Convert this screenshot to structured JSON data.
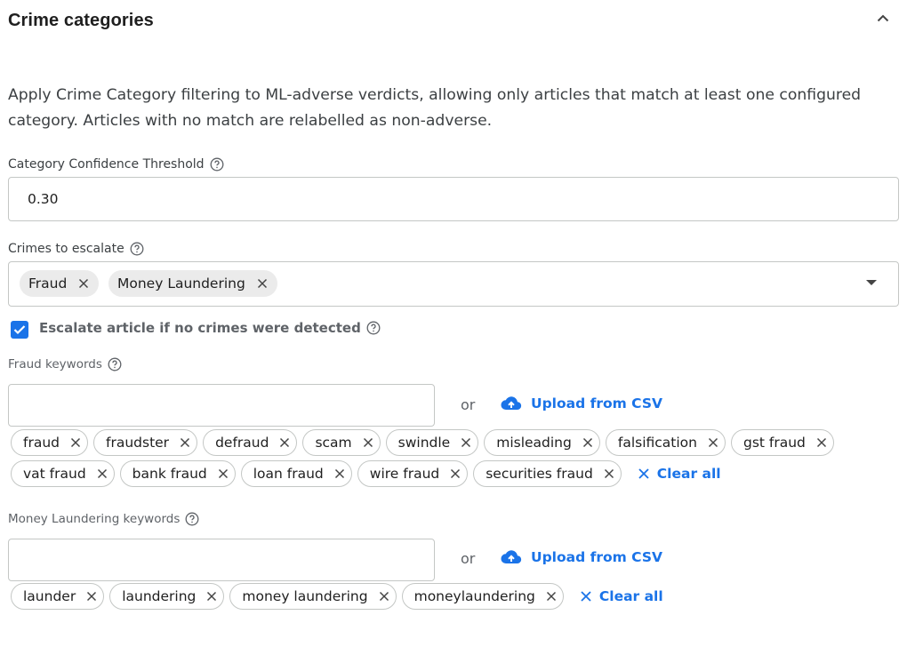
{
  "section": {
    "title": "Crime categories",
    "description": "Apply Crime Category filtering to ML-adverse verdicts, allowing only articles that match at least one configured category. Articles with no match are relabelled as non-adverse."
  },
  "threshold": {
    "label": "Category Confidence Threshold",
    "value": "0.30"
  },
  "crimes": {
    "label": "Crimes to escalate",
    "selected": [
      "Fraud",
      "Money Laundering"
    ]
  },
  "escalate_checkbox": {
    "label": "Escalate article if no crimes were detected",
    "checked": true
  },
  "fraud_keywords": {
    "label": "Fraud keywords",
    "input_value": "",
    "or_text": "or",
    "upload_label": "Upload from CSV",
    "clear_label": "Clear all",
    "chips": [
      "fraud",
      "fraudster",
      "defraud",
      "scam",
      "swindle",
      "misleading",
      "falsification",
      "gst fraud",
      "vat fraud",
      "bank fraud",
      "loan fraud",
      "wire fraud",
      "securities fraud"
    ]
  },
  "ml_keywords": {
    "label": "Money Laundering keywords",
    "input_value": "",
    "or_text": "or",
    "upload_label": "Upload from CSV",
    "clear_label": "Clear all",
    "chips": [
      "launder",
      "laundering",
      "money laundering",
      "moneylaundering"
    ]
  },
  "colors": {
    "accent": "#1a73e8",
    "chip_fill": "#ebebeb",
    "border": "#c4c7c5"
  },
  "icons": {
    "collapse": "chevron-up-icon",
    "help": "help-circle-icon",
    "remove": "close-icon",
    "upload": "cloud-upload-icon",
    "dropdown": "caret-down-icon",
    "check": "check-icon"
  }
}
